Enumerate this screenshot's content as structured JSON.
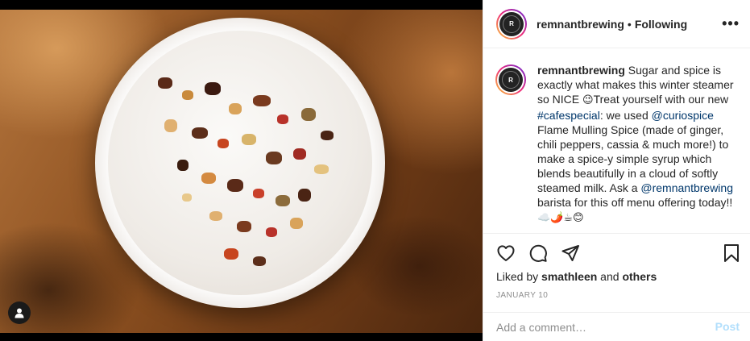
{
  "post": {
    "username": "remnantbrewing",
    "separator": "•",
    "follow_status": "Following",
    "more_icon": "•••",
    "logo_letter": "R"
  },
  "caption": {
    "username": "remnantbrewing",
    "part1": " Sugar and spice is exactly what makes this winter steamer so NICE ",
    "emoji1": "😉",
    "part2": "Treat yourself with our new ",
    "hashtag": "#cafespecial",
    "part3": ": we used ",
    "mention1": "@curiospice",
    "part4": " Flame Mulling Spice (made of ginger, chili peppers, cassia & much more!) to make a spice-y simple syrup which blends beautifully in a cloud of softly steamed milk. Ask a ",
    "mention2": "@remnantbrewing",
    "part5": " barista for this off menu offering today!! ",
    "emoji_tail": "☁️🌶️☕😊"
  },
  "actions": {
    "icons": [
      "heart-icon",
      "comment-icon",
      "share-icon",
      "bookmark-icon"
    ]
  },
  "likes": {
    "prefix": "Liked by ",
    "user": "smathleen",
    "middle": " and ",
    "others": "others"
  },
  "date": "JANUARY 10",
  "comment": {
    "placeholder": "Add a comment…",
    "post_label": "Post"
  },
  "colors": {
    "link": "#00376b",
    "post_button_disabled": "#b2dffc",
    "text": "#262626",
    "muted": "#8e8e8e"
  }
}
